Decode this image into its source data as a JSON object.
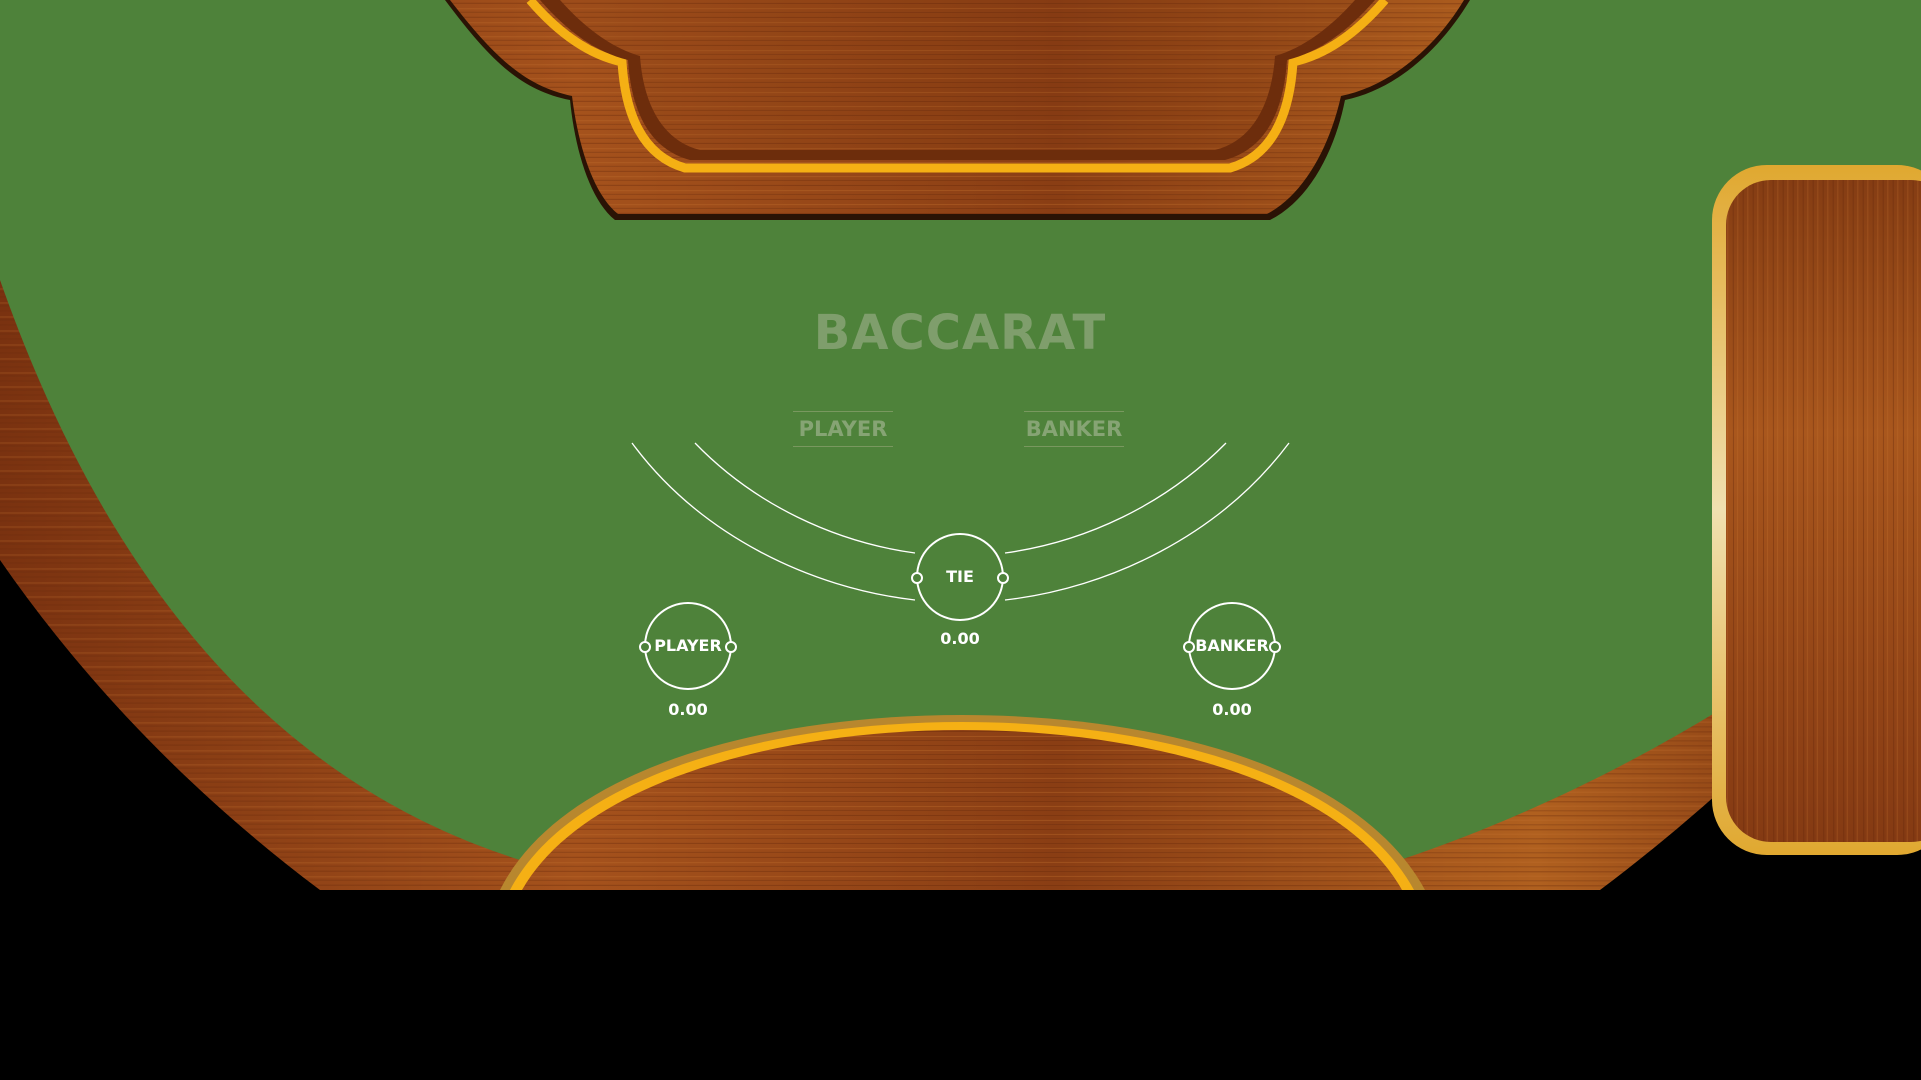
{
  "table": {
    "title": "BACCARAT",
    "felt_color": "#4e823a",
    "wood_color": "#8b3f12",
    "trim_color": "#f5b014",
    "side_labels": {
      "player": "PLAYER",
      "banker": "BANKER"
    }
  },
  "bets": {
    "tie": {
      "label": "TIE",
      "amount": "0.00"
    },
    "player": {
      "label": "PLAYER",
      "amount": "0.00"
    },
    "banker": {
      "label": "BANKER",
      "amount": "0.00"
    }
  }
}
